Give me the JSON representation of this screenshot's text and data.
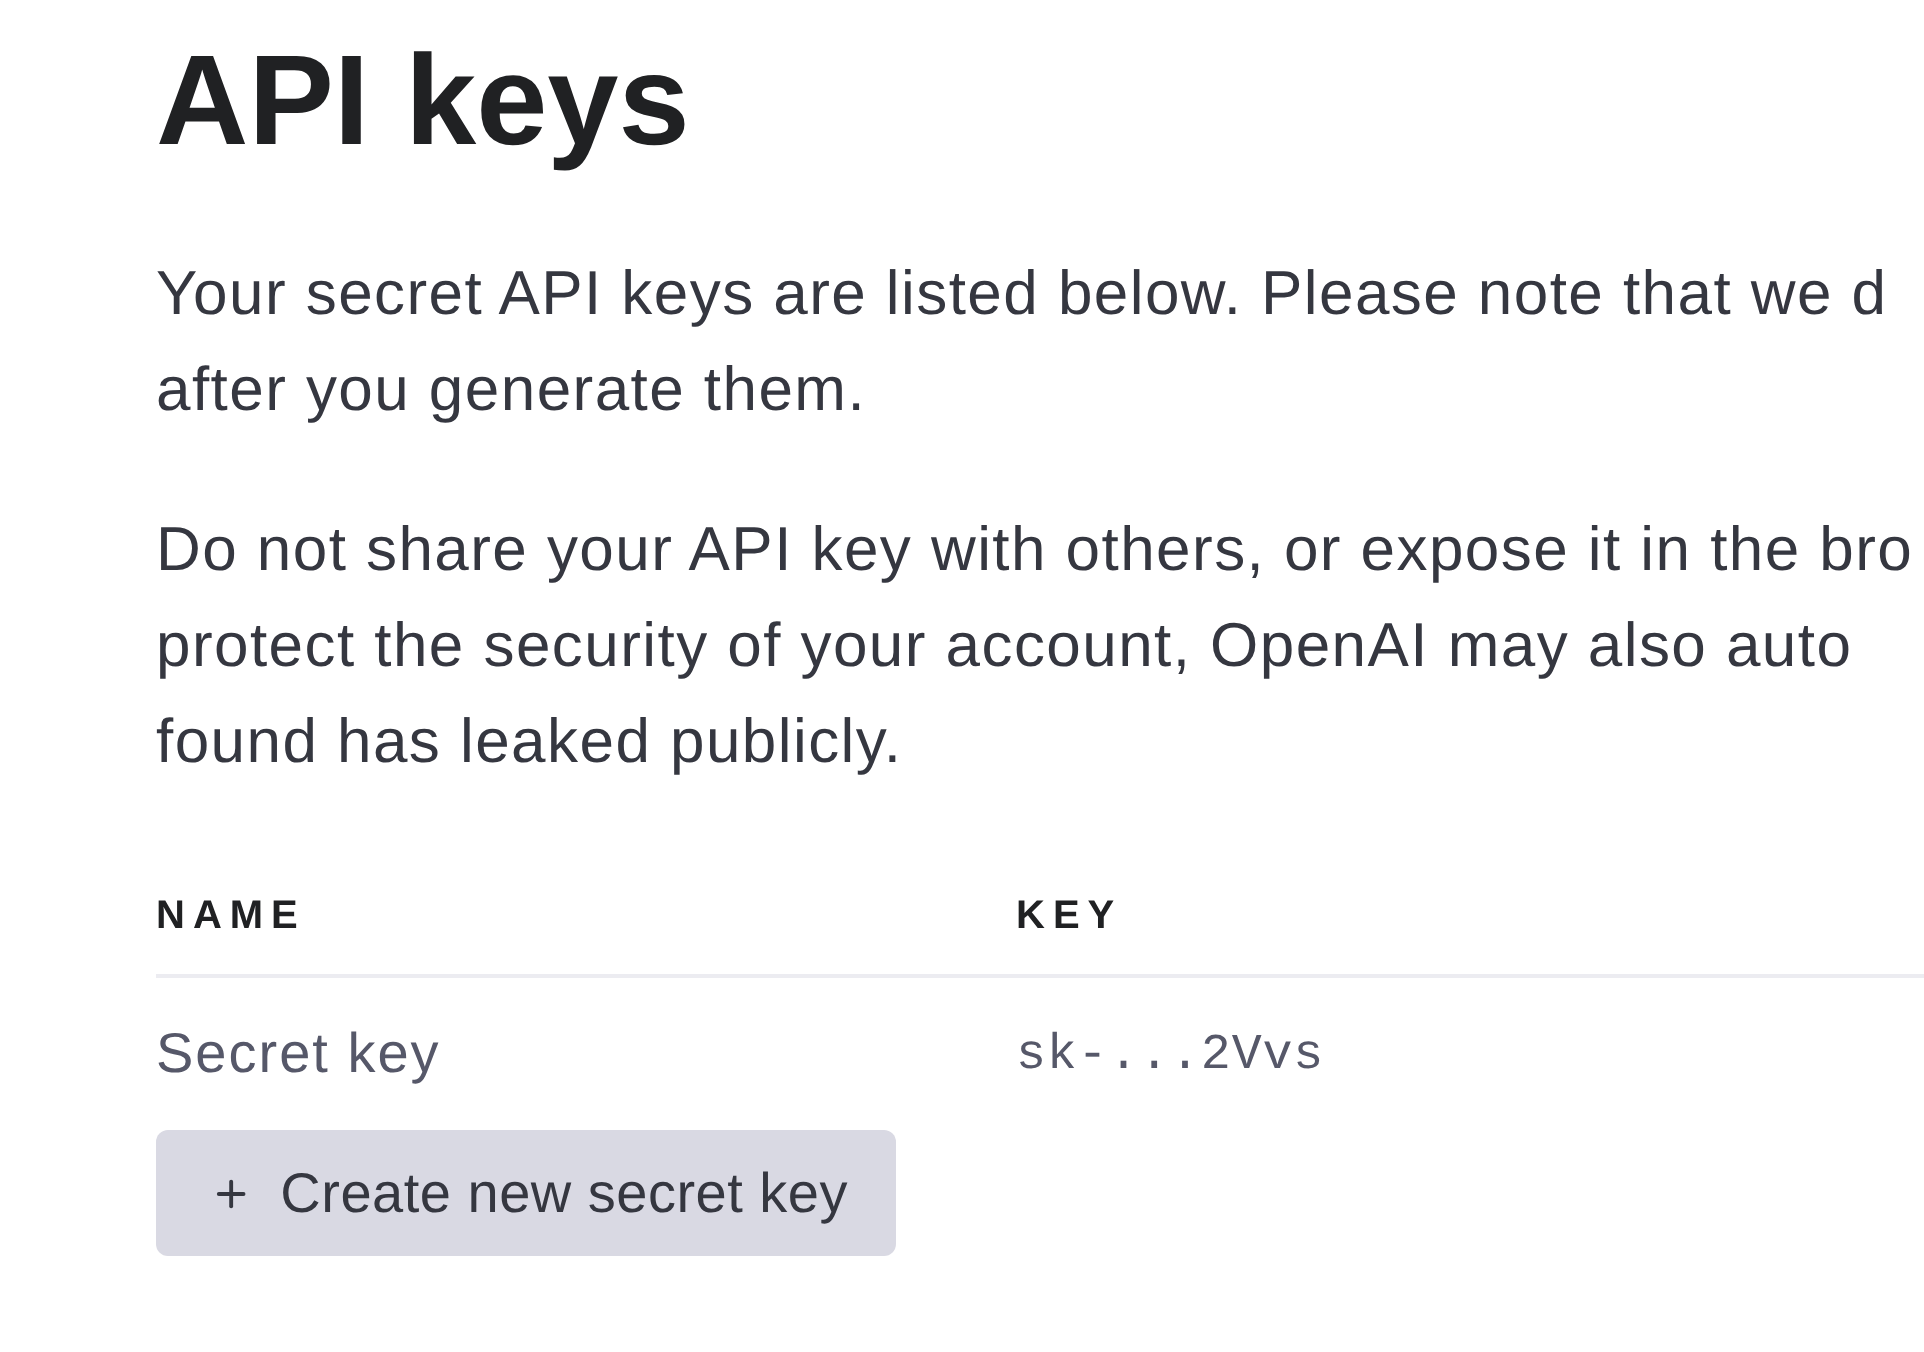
{
  "title": "API keys",
  "paragraphs": [
    {
      "lines": [
        "Your secret API keys are listed below. Please note that we d",
        "after you generate them."
      ]
    },
    {
      "lines": [
        "Do not share your API key with others, or expose it in the bro",
        "protect the security of your account, OpenAI may also auto",
        "found has leaked publicly."
      ]
    }
  ],
  "table": {
    "columns": [
      "NAME",
      "KEY"
    ],
    "rows": [
      {
        "name": "Secret key",
        "key": "sk-...2Vvs"
      }
    ]
  },
  "create_button": {
    "label": "Create new secret key"
  }
}
